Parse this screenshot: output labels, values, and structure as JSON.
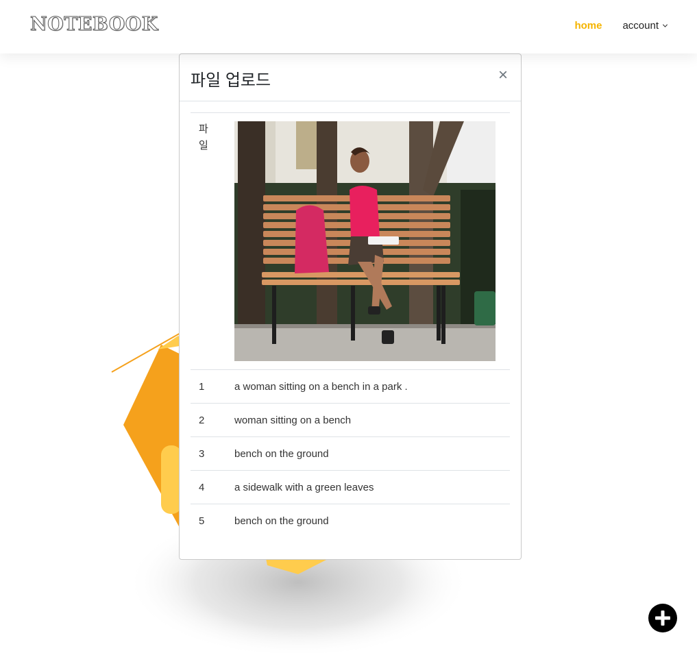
{
  "header": {
    "logo": "NOTEBOOK",
    "nav": {
      "home_label": "home",
      "account_label": "account"
    }
  },
  "modal": {
    "title": "파일 업로드",
    "close_symbol": "×",
    "file_label": "파일",
    "image_alt": "a woman sitting on a bench in a park",
    "captions": [
      {
        "index": "1",
        "text": "a woman sitting on a bench in a park ."
      },
      {
        "index": "2",
        "text": "woman sitting on a bench"
      },
      {
        "index": "3",
        "text": "bench on the ground"
      },
      {
        "index": "4",
        "text": "a sidewalk with a green leaves"
      },
      {
        "index": "5",
        "text": "bench on the ground"
      }
    ]
  },
  "icons": {
    "chevron": "chevron-down-icon",
    "fab": "plus-circle-icon",
    "close": "close-icon"
  },
  "colors": {
    "accent": "#f5b400",
    "illustration_orange": "#f5a11c",
    "illustration_yellow": "#ffcc4d"
  }
}
